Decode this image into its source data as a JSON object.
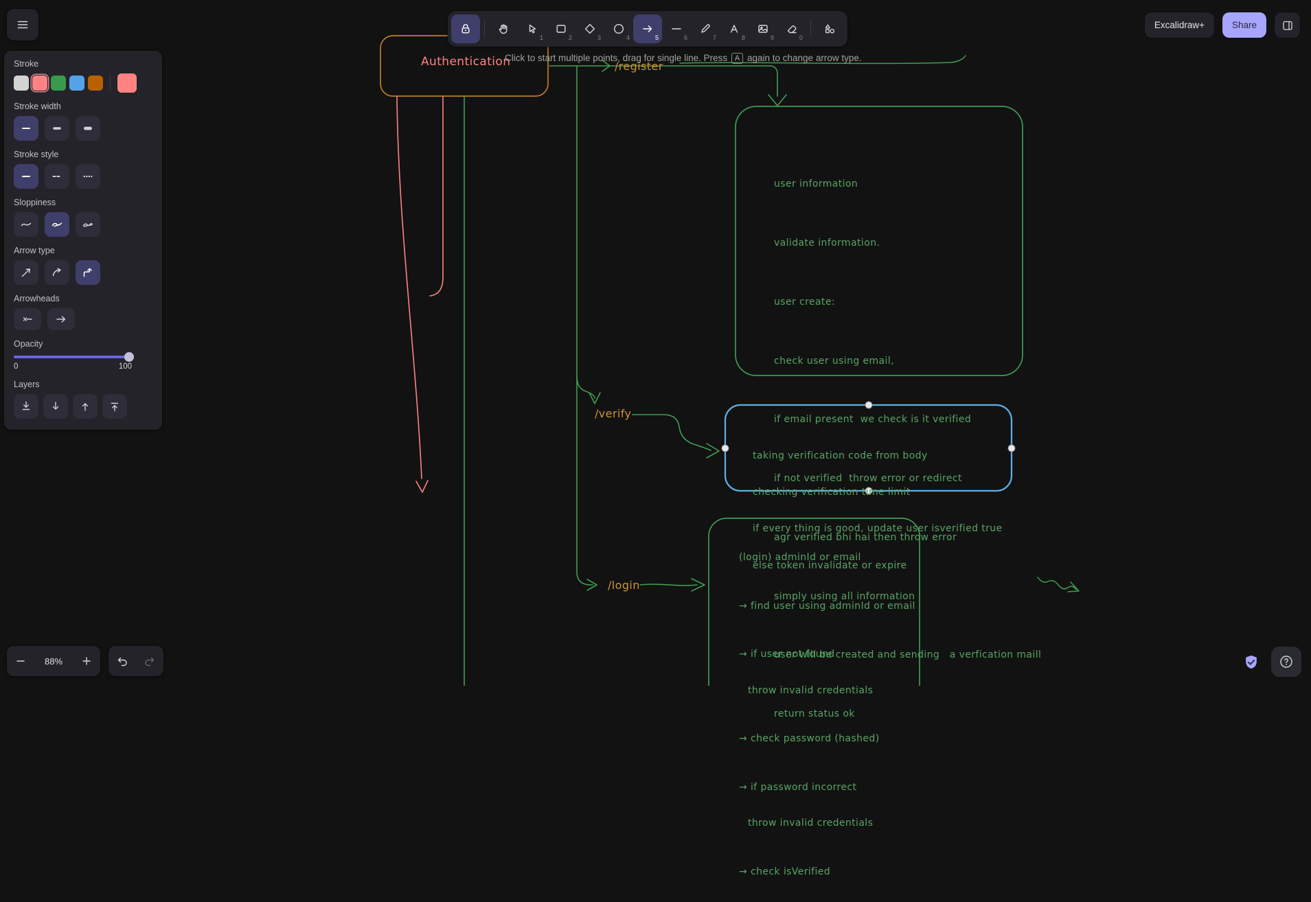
{
  "app": {
    "canvas_bg": "#121212",
    "panel_bg": "#232329",
    "accent": "#a8a5ff",
    "active_tool_bg": "#403e6a"
  },
  "topbar": {
    "excalidraw_plus_label": "Excalidraw+",
    "share_label": "Share",
    "tools": [
      {
        "name": "lock",
        "key": "",
        "active": true
      },
      {
        "name": "hand",
        "key": "",
        "active": false
      },
      {
        "name": "selection",
        "key": "1",
        "active": false
      },
      {
        "name": "rectangle",
        "key": "2",
        "active": false
      },
      {
        "name": "diamond",
        "key": "3",
        "active": false
      },
      {
        "name": "ellipse",
        "key": "4",
        "active": false
      },
      {
        "name": "arrow",
        "key": "5",
        "active": true
      },
      {
        "name": "line",
        "key": "6",
        "active": false
      },
      {
        "name": "draw",
        "key": "7",
        "active": false
      },
      {
        "name": "text",
        "key": "8",
        "active": false
      },
      {
        "name": "image",
        "key": "9",
        "active": false
      },
      {
        "name": "eraser",
        "key": "0",
        "active": false
      },
      {
        "name": "shapes",
        "key": "",
        "active": false
      }
    ]
  },
  "hint": {
    "before": "Click to start multiple points, drag for single line. Press ",
    "key": "A",
    "after": " again to change arrow type."
  },
  "left_panel": {
    "stroke": {
      "label": "Stroke",
      "colors": [
        "#d3d3d3",
        "#ff8383",
        "#3a994c",
        "#56a2e8",
        "#b76100"
      ],
      "selected": "#ff8383"
    },
    "stroke_width": {
      "label": "Stroke width",
      "options": [
        "thin",
        "bold",
        "extra-bold"
      ],
      "selected": "thin"
    },
    "stroke_style": {
      "label": "Stroke style",
      "options": [
        "solid",
        "dashed",
        "dotted"
      ],
      "selected": "solid"
    },
    "sloppiness": {
      "label": "Sloppiness",
      "options": [
        "architect",
        "artist",
        "cartoonist"
      ],
      "selected": "artist"
    },
    "arrow_type": {
      "label": "Arrow type",
      "options": [
        "straight",
        "curved",
        "elbow"
      ],
      "selected": "elbow"
    },
    "arrowheads": {
      "label": "Arrowheads",
      "start": "none",
      "end": "arrow"
    },
    "opacity": {
      "label": "Opacity",
      "min": "0",
      "max": "100",
      "value": 100
    },
    "layers": {
      "label": "Layers",
      "options": [
        "send-to-back",
        "send-backward",
        "bring-forward",
        "bring-to-front"
      ]
    }
  },
  "canvas": {
    "auth_box": {
      "label": "Authentication",
      "stroke": "#c07b28",
      "text_color": "#ff8383"
    },
    "labels": {
      "register": "/register",
      "verify": "/verify",
      "login": "/login",
      "color": "#cf9433"
    },
    "register_box": {
      "stroke": "#3e9b52",
      "text_color": "#58a564",
      "lines": [
        "user information",
        "validate information.",
        "user create:",
        "check user using email,",
        "if email present  we check is it verified",
        "if not verified  throw error or redirect",
        "agr verified bhi hai then throw error",
        "simply using all information",
        "user will be created and sending   a verfication maill",
        "return status ok"
      ]
    },
    "verify_box": {
      "stroke": "#5fafe8",
      "text_color": "#58a564",
      "lines": [
        "taking verification code from body",
        "checking verification time limit",
        "if every thing is good, update user isverified true",
        "else token invalidate or expire"
      ]
    },
    "login_box": {
      "stroke": "#3e9b52",
      "text_color": "#58a564",
      "lines": [
        {
          "text": "(login) adminId or email"
        },
        {
          "text": "→ find user using adminId or email"
        },
        {
          "text": "→ if user not found"
        },
        {
          "text": "throw invalid credentials"
        },
        {
          "text": "→ check password (hashed)"
        },
        {
          "text": "→ if password incorrect"
        },
        {
          "text": "throw invalid credentials"
        },
        {
          "text": "→ check isVerified"
        }
      ]
    },
    "arrow_color": "#3f9e52",
    "pending_color": "#ff8383"
  },
  "footer": {
    "zoom_level": "88%"
  }
}
